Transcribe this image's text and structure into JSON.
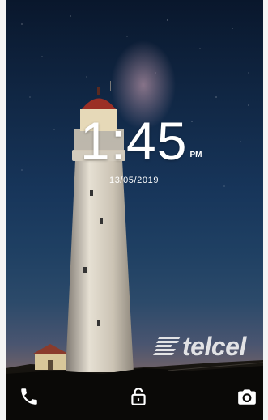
{
  "lockscreen": {
    "time": "1:45",
    "ampm": "PM",
    "date": "13/05/2019"
  },
  "carrier": {
    "brand_text": "telcel"
  },
  "shortcuts": {
    "left": {
      "icon": "phone-icon"
    },
    "center": {
      "icon": "unlock-icon"
    },
    "right": {
      "icon": "camera-icon"
    }
  },
  "colors": {
    "text": "#ffffff",
    "sky_top": "#09172c",
    "sky_horizon": "#8a6a5a"
  }
}
